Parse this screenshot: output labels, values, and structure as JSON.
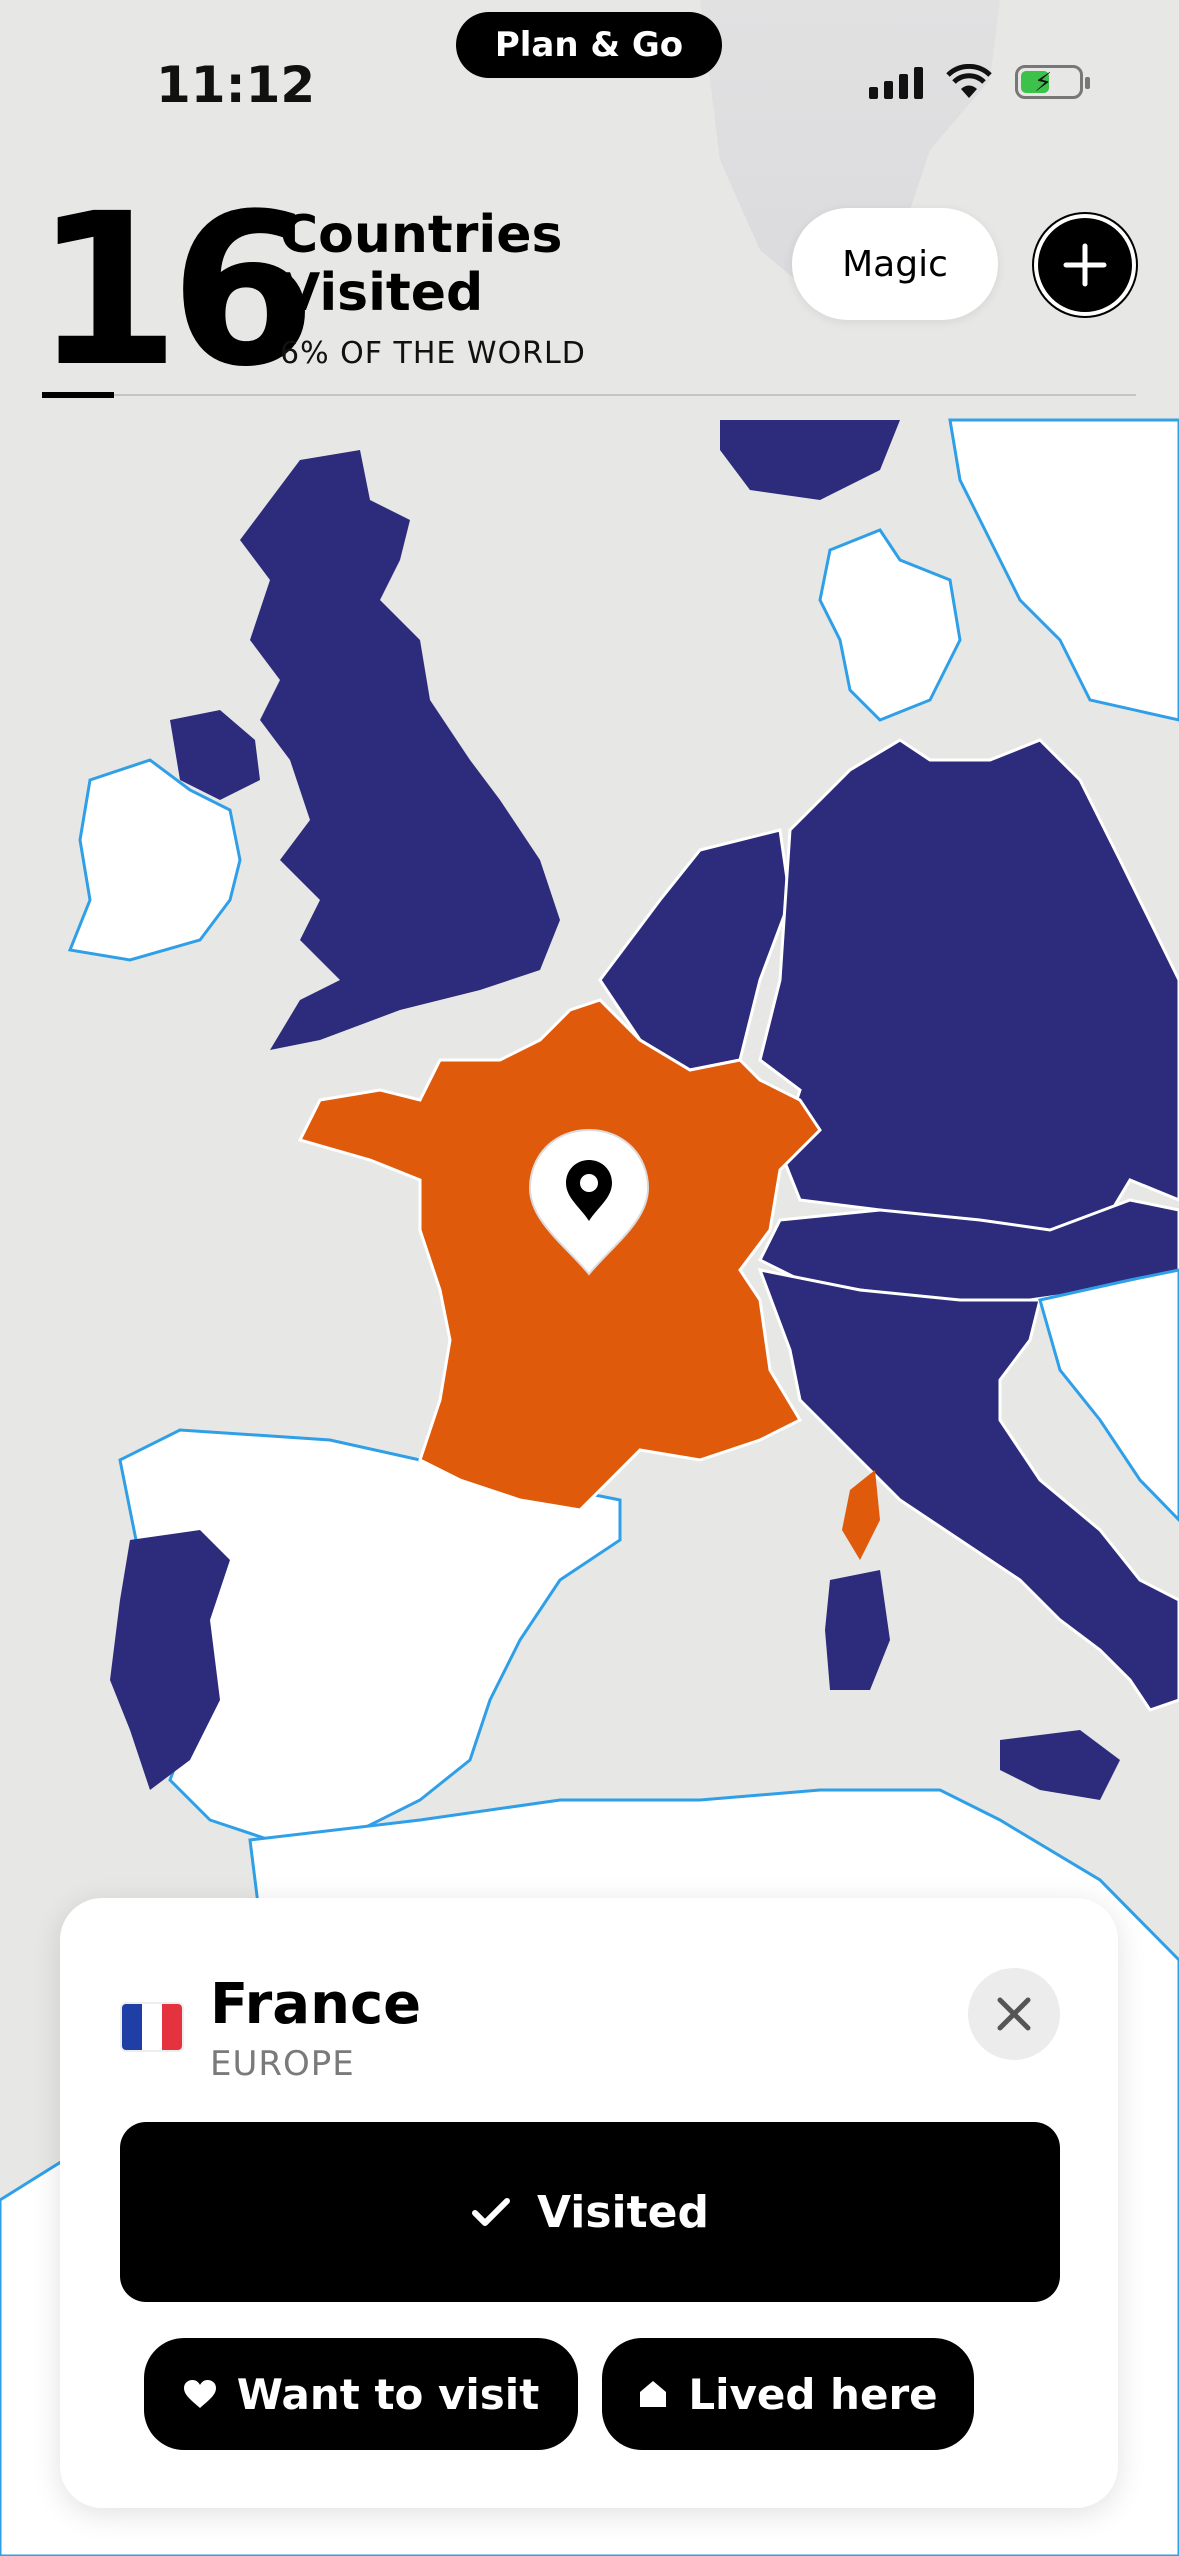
{
  "status_bar": {
    "time": "11:12"
  },
  "dynamic_island": {
    "label": "Plan & Go"
  },
  "stats": {
    "count": "16",
    "label_line1": "Countries",
    "label_line2": "Visited",
    "subtitle": "6% OF THE WORLD"
  },
  "header_buttons": {
    "magic": "Magic",
    "add_icon": "plus-icon"
  },
  "map": {
    "colors": {
      "background": "#e7e7e5",
      "unvisited": "#ffffff",
      "visited": "#2c2b7c",
      "selected": "#e05a0c",
      "border": "#2f9fe8"
    },
    "selected_country": "France",
    "marker_icon": "location-pin-icon"
  },
  "card": {
    "flag_colors": [
      "#1f3fa6",
      "#ffffff",
      "#e5323f"
    ],
    "country": "France",
    "continent": "EUROPE",
    "close_icon": "close-icon",
    "primary_button": {
      "label": "Visited",
      "icon": "check-icon"
    },
    "want_button": {
      "label": "Want to visit",
      "icon": "heart-icon"
    },
    "lived_button": {
      "label": "Lived here",
      "icon": "home-icon"
    }
  }
}
